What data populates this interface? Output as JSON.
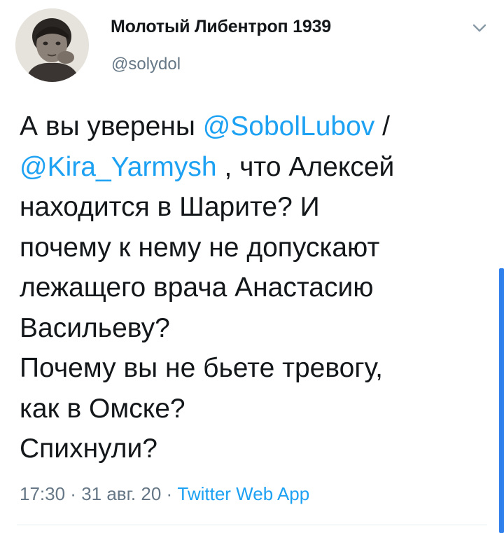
{
  "author": {
    "display_name": "Молотый Либентроп 1939",
    "handle": "@solydol",
    "avatar_icon": "child-photo-avatar"
  },
  "tweet": {
    "line1_text": "А вы уверены ",
    "mention1": "@SobolLubov",
    "line1_tail": " /",
    "mention2": "@Kira_Yarmysh",
    "body_after_mentions": " , что Алексей\nнаходится в Шарите? И\nпочему к нему не допускают\nлежащего врача Анастасию\nВасильеву?\nПочему вы не бьете тревогу,\nкак в Омске?\nСпихнули?"
  },
  "meta": {
    "time": "17:30",
    "sep1": " · ",
    "date": "31 авг. 20",
    "sep2": " · ",
    "source": "Twitter Web App"
  },
  "icons": {
    "menu_caret": "chevron-down-icon"
  },
  "colors": {
    "link": "#1da1f2",
    "secondary_text": "#657786",
    "primary_text": "#14171a",
    "scrollbar": "#2f80ed"
  }
}
